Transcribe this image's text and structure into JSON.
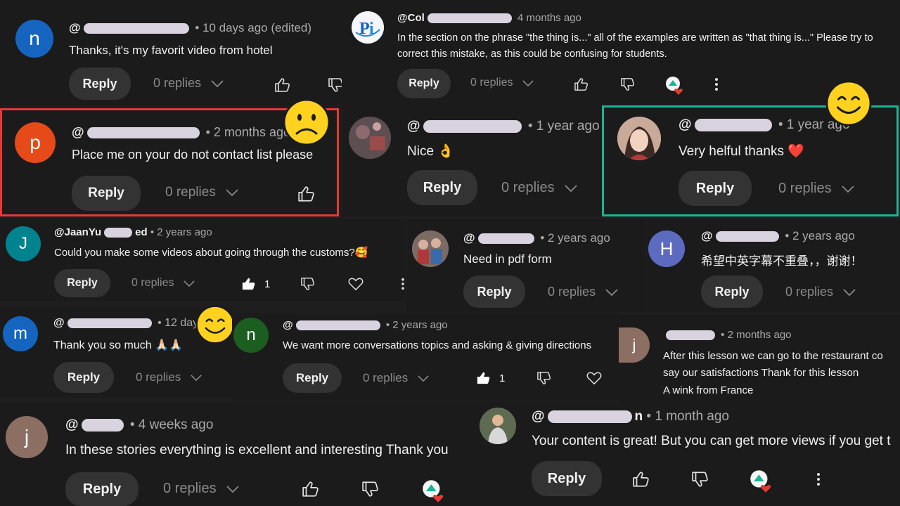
{
  "common": {
    "reply": "Reply",
    "replies": "0 replies",
    "dot": "•"
  },
  "comments": [
    {
      "handle_prefix": "@",
      "handle_suffix": "",
      "time": "10 days ago (edited)",
      "text": "Thanks, it's my favorit video from  hotel",
      "initial": "n",
      "avatar_color": "#1565c0"
    },
    {
      "handle_prefix": "@Col",
      "handle_suffix": "",
      "time": "4 months ago",
      "text_line1": "In the section on the phrase \"the thing is...\" all of the examples are written as \"that thing is...\" Please try to",
      "text_line2": "correct this mistake, as this could be confusing for students."
    },
    {
      "handle_prefix": "@",
      "time": "2 months ago",
      "text": "Place me on your do not contact list please",
      "initial": "p",
      "avatar_color": "#e64a19",
      "highlight": "#e53935"
    },
    {
      "handle_prefix": "@",
      "time": "1 year ago",
      "text": "Nice 👌"
    },
    {
      "handle_prefix": "@",
      "time": "1 year ago",
      "text": "Very helful thanks ❤️",
      "highlight": "#1ab394"
    },
    {
      "handle_prefix": "@JaanYu",
      "handle_suffix": "ed",
      "time": "2 years ago",
      "text": "Could you make some videos about going through the customs?🥰",
      "initial": "J",
      "avatar_color": "#00838f",
      "likes": "1"
    },
    {
      "handle_prefix": "@",
      "time": "2 years ago",
      "text": "Need in pdf form"
    },
    {
      "handle_prefix": "@",
      "time": "2 years ago",
      "text": "希望中英字幕不重叠，，谢谢！",
      "initial": "H",
      "avatar_color": "#5c6bc0"
    },
    {
      "handle_prefix": "@",
      "time": "12 days",
      "text": "Thank you so much 🙏🏻🙏🏻",
      "initial": "m",
      "avatar_color": "#1565c0"
    },
    {
      "handle_prefix": "@",
      "time": "2 years ago",
      "text": "We want more  conversations topics and asking & giving directions",
      "initial": "n",
      "avatar_color": "#1b5e20",
      "likes": "1"
    },
    {
      "handle_prefix": "",
      "time": "2 months ago",
      "text_line1": "After this lesson we can go to the restaurant co",
      "text_line2": "say our satisfactions  Thank for this lesson",
      "text_line3": "A wink from France",
      "initial": "j",
      "avatar_color": "#8d6e63"
    },
    {
      "handle_prefix": "@",
      "time": "4 weeks ago",
      "text": "In these stories everything is excellent and interesting Thank you",
      "initial": "j",
      "avatar_color": "#8d6e63"
    },
    {
      "handle_prefix": "@",
      "handle_suffix": "n",
      "time": "1 month ago",
      "text": "Your content is great! But you can get more views if you get t"
    }
  ],
  "icons": {
    "like": "thumbs-up-icon",
    "dislike": "thumbs-down-icon",
    "heart": "heart-icon",
    "more": "more-vert-icon",
    "chevron": "chevron-down-icon",
    "creator_heart": "creator-heart-icon",
    "sad": "sad-face-emoji",
    "happy": "happy-face-emoji"
  }
}
